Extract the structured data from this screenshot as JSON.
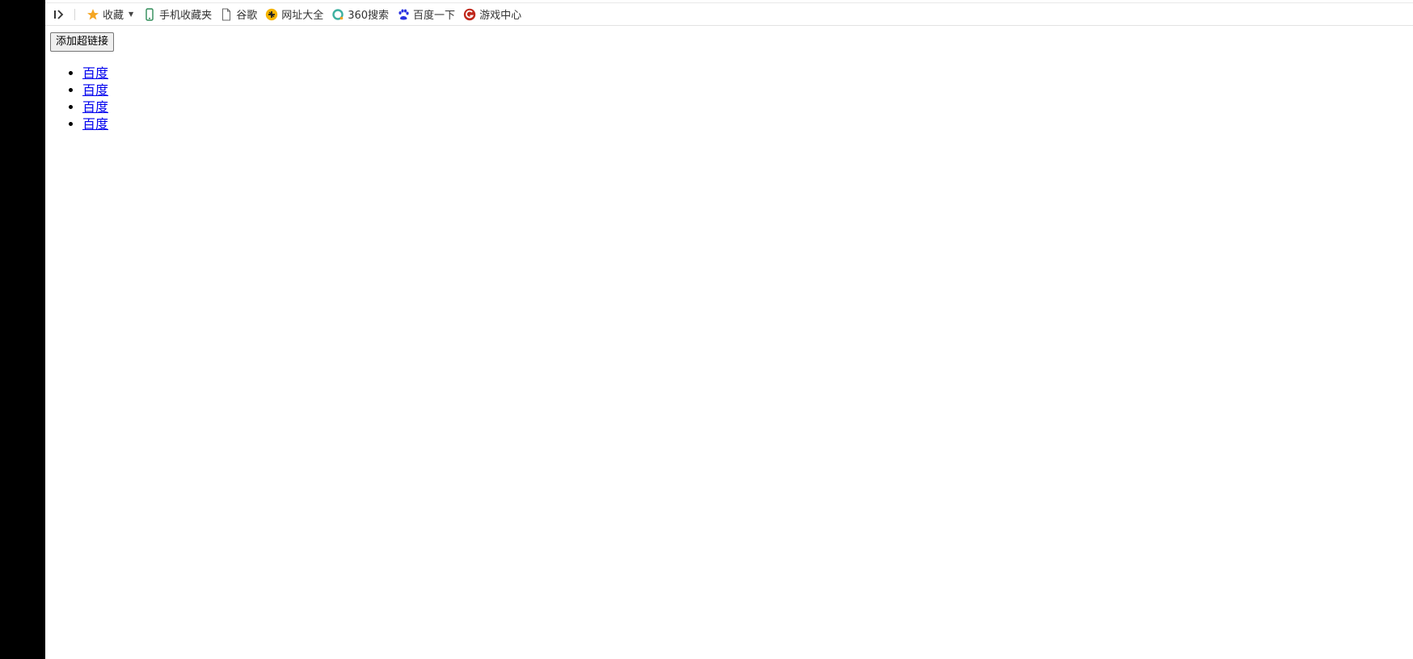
{
  "bookmarks_bar": {
    "items": [
      {
        "label": "收藏",
        "icon": "star-icon"
      },
      {
        "label": "手机收藏夹",
        "icon": "phone-icon"
      },
      {
        "label": "谷歌",
        "icon": "page-icon"
      },
      {
        "label": "网址大全",
        "icon": "hao123-icon"
      },
      {
        "label": "360搜索",
        "icon": "360-search-icon"
      },
      {
        "label": "百度一下",
        "icon": "baidu-paw-icon"
      },
      {
        "label": "游戏中心",
        "icon": "game-center-icon"
      }
    ]
  },
  "page": {
    "add_button_label": "添加超链接",
    "links": [
      {
        "text": "百度"
      },
      {
        "text": "百度"
      },
      {
        "text": "百度"
      },
      {
        "text": "百度"
      }
    ]
  },
  "colors": {
    "link": "#0000ee",
    "star": "#f5a623",
    "left_bar": "#000000"
  }
}
